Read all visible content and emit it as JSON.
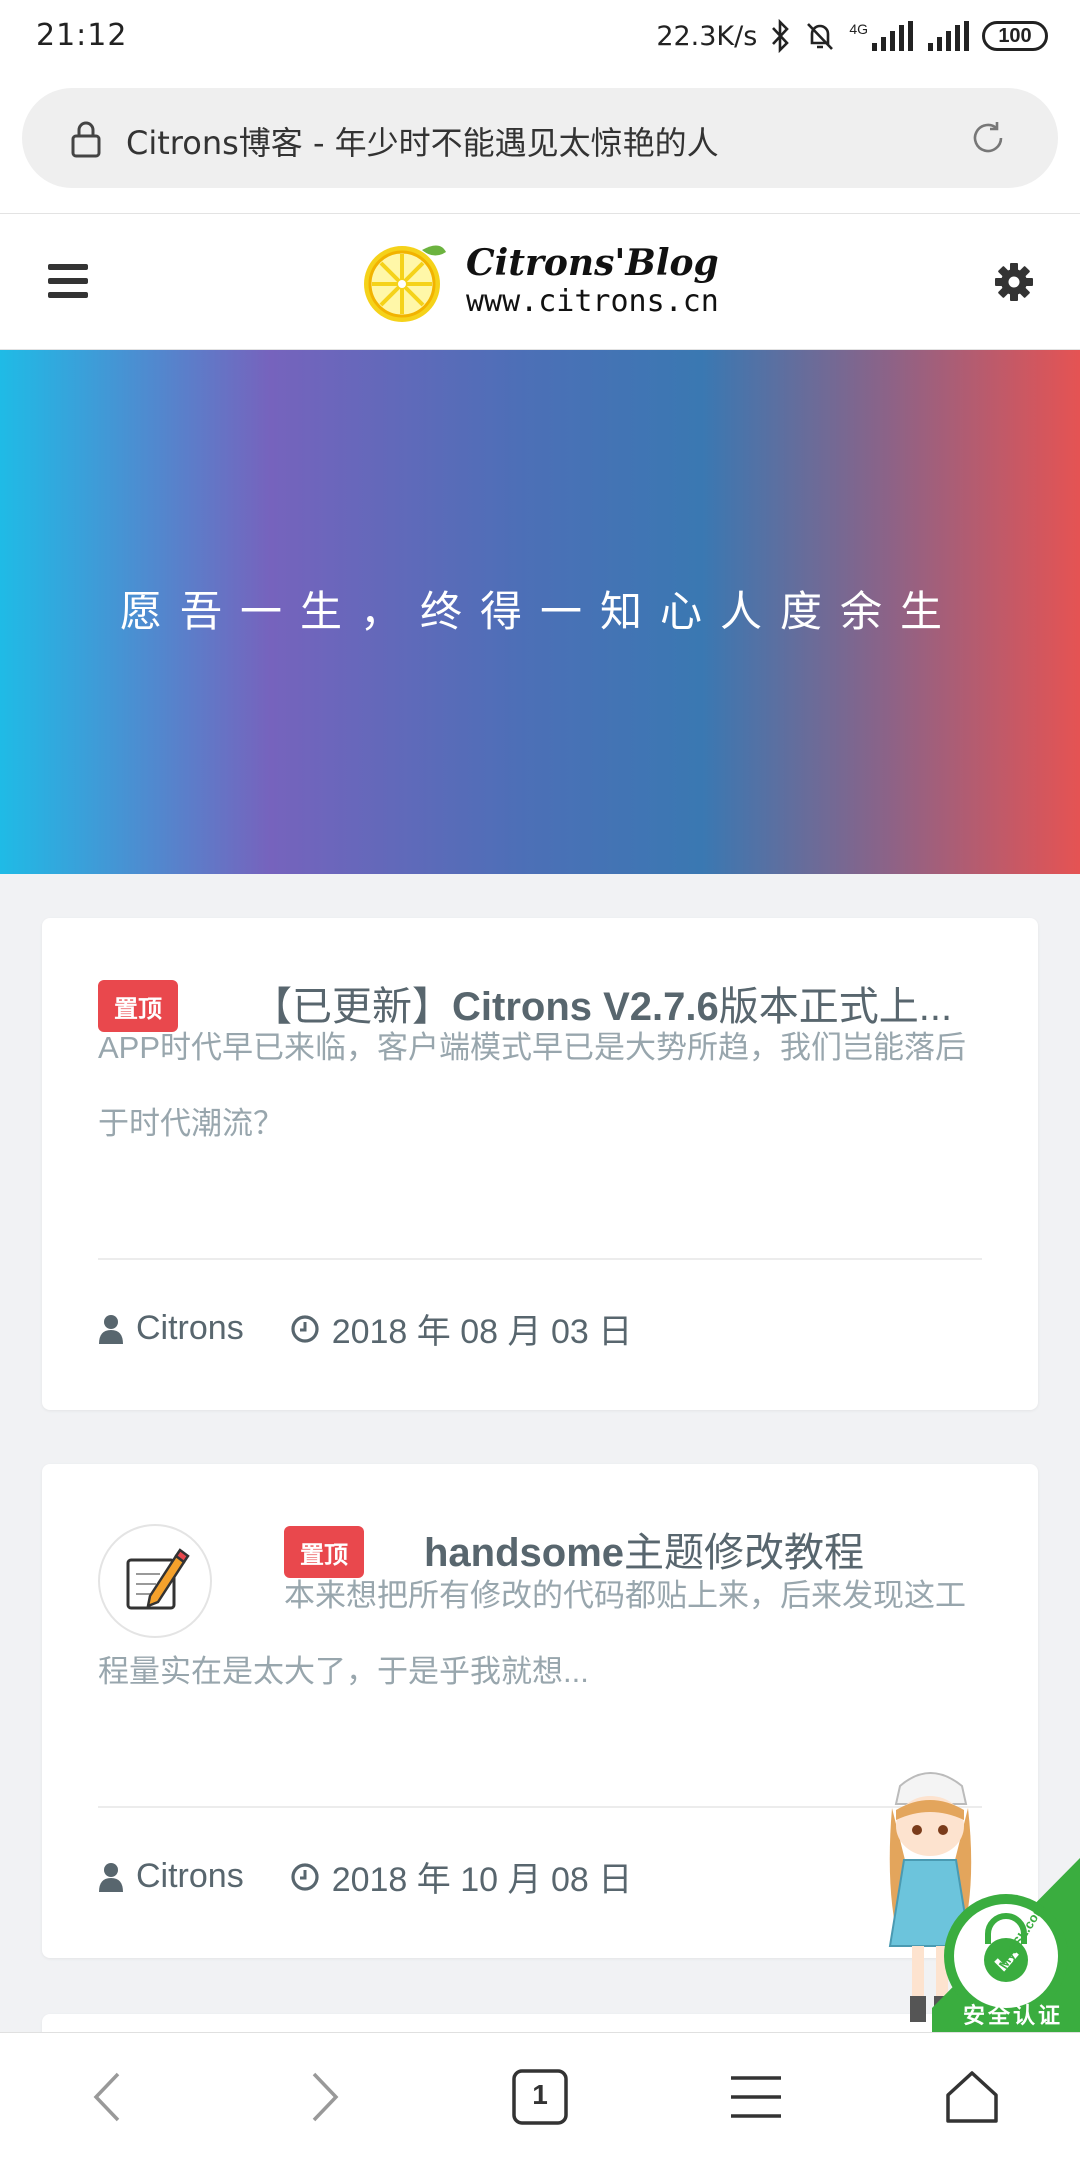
{
  "status_bar": {
    "time": "21:12",
    "network_speed": "22.3K/s",
    "network_type": "4G",
    "battery": "100",
    "icons": [
      "bluetooth-icon",
      "mute-icon",
      "signal-icon",
      "signal-icon",
      "battery-icon"
    ]
  },
  "address_bar": {
    "title": "Citrons博客 - 年少时不能遇见太惊艳的人",
    "icons": [
      "lock-icon",
      "reload-icon"
    ]
  },
  "header": {
    "logo_title": "Citrons'Blog",
    "logo_url": "www.citrons.cn",
    "icons": [
      "menu-icon",
      "lemon-logo-icon",
      "gear-icon"
    ]
  },
  "banner": {
    "text": "愿吾一生，终得一知心人度余生",
    "colors": [
      "#1fbbe6",
      "#7663bd",
      "#3a78b2",
      "#e55353"
    ]
  },
  "posts": [
    {
      "badge": "置顶",
      "title_prefix": "【已更新】",
      "title_bold": "Citrons V2.7.6",
      "title_suffix": "版本正式上...",
      "excerpt": "APP时代早已来临，客户端模式早已是大势所趋，我们岂能落后于时代潮流？",
      "author": "Citrons",
      "date": "2018 年 08 月 03 日"
    },
    {
      "badge": "置顶",
      "title_bold": "handsome",
      "title_suffix": "主题修改教程",
      "excerpt": "本来想把所有修改的代码都贴上来，后来发现这工程量实在是太大了，于是乎我就想...",
      "author": "Citrons",
      "date": "2018 年 10 月 08 日",
      "thumb_icon": "memo-pencil-icon"
    }
  ],
  "ssl_badge": {
    "label": "安全认证",
    "brand": "MySSL.com",
    "color": "#3aad3f"
  },
  "bottom_nav": {
    "tab_count": "1",
    "icons": [
      "back-icon",
      "forward-icon",
      "tabs-icon",
      "menu-icon",
      "home-icon"
    ]
  },
  "colors": {
    "badge": "#e9484d",
    "title": "#58666e",
    "excerpt": "#98a6ad"
  }
}
